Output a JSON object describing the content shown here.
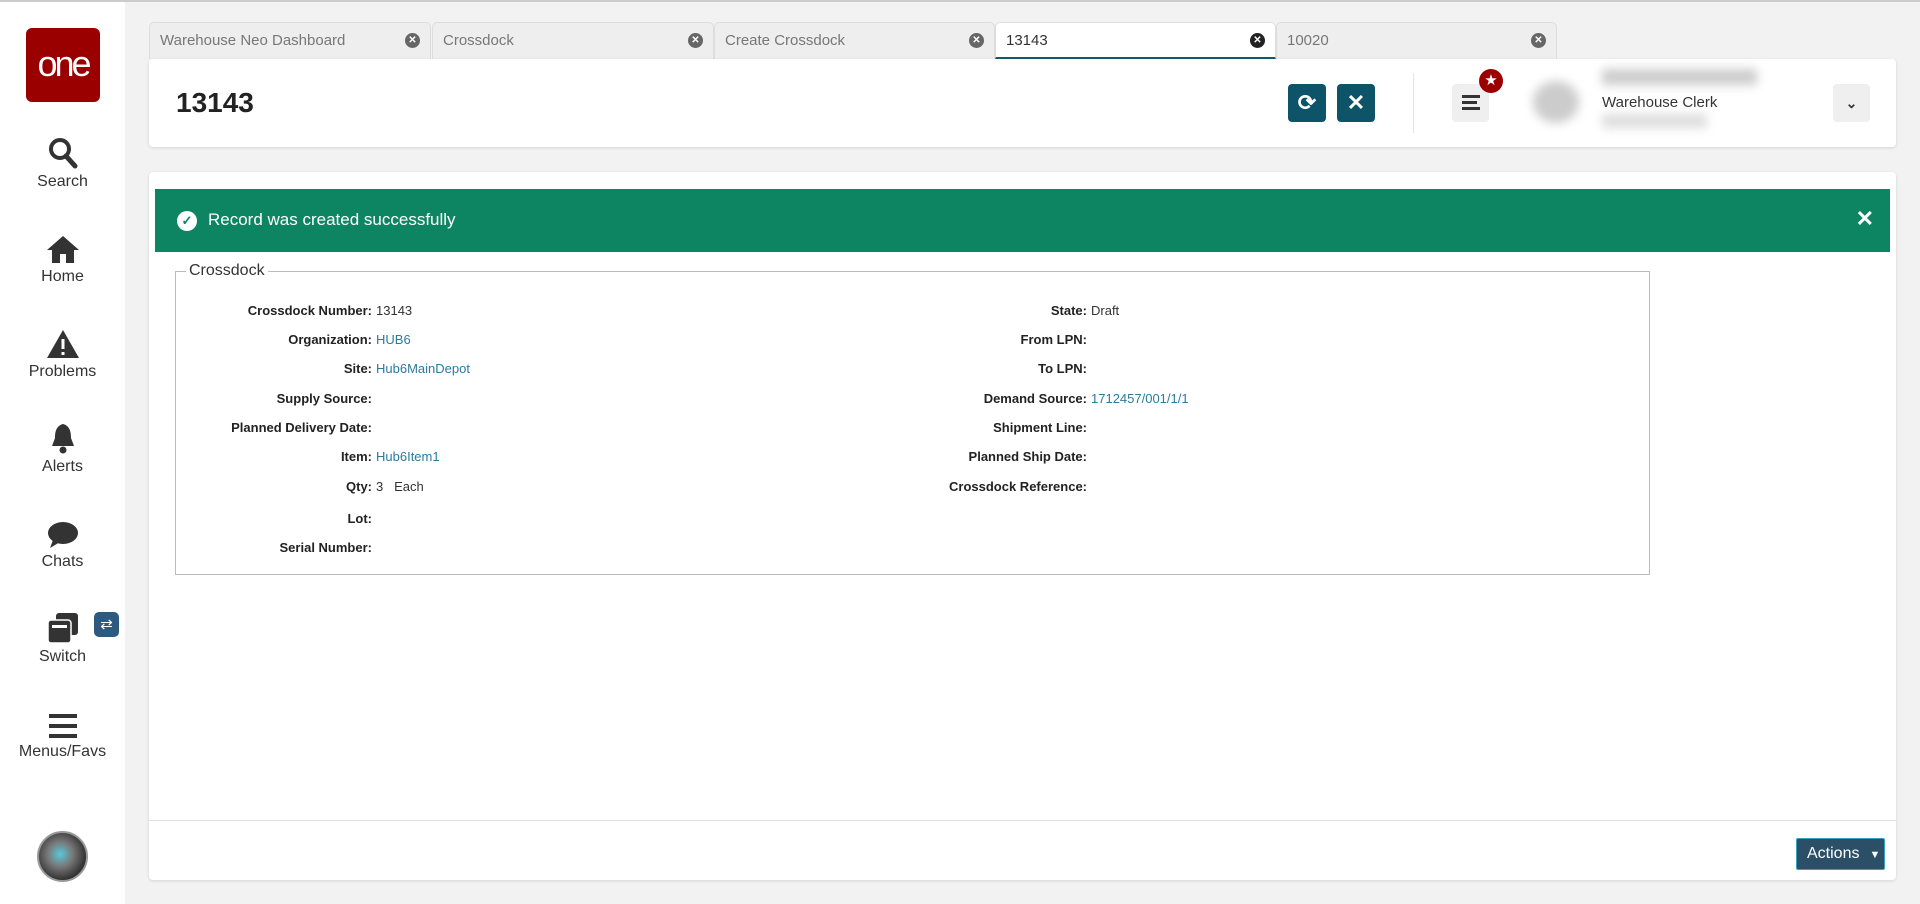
{
  "sidebar": {
    "logo": "one",
    "items": [
      {
        "label": "Search"
      },
      {
        "label": "Home"
      },
      {
        "label": "Problems"
      },
      {
        "label": "Alerts"
      },
      {
        "label": "Chats"
      },
      {
        "label": "Switch"
      },
      {
        "label": "Menus/Favs"
      }
    ],
    "switch_badge": "⇄"
  },
  "tabs": [
    {
      "label": "Warehouse Neo Dashboard"
    },
    {
      "label": "Crossdock"
    },
    {
      "label": "Create Crossdock"
    },
    {
      "label": "13143",
      "active": true
    },
    {
      "label": "10020"
    }
  ],
  "header": {
    "title": "13143",
    "user_role": "Warehouse Clerk"
  },
  "banner": {
    "message": "Record was created successfully"
  },
  "section": {
    "legend": "Crossdock",
    "left": [
      {
        "label": "Crossdock Number:",
        "value": "13143"
      },
      {
        "label": "Organization:",
        "value": "HUB6"
      },
      {
        "label": "Site:",
        "value": "Hub6MainDepot"
      },
      {
        "label": "Supply Source:",
        "value": ""
      },
      {
        "label": "Planned Delivery Date:",
        "value": ""
      },
      {
        "label": "Item:",
        "value": "Hub6Item1"
      },
      {
        "label": "Qty:",
        "value": "3   Each"
      },
      {
        "label": "Lot:",
        "value": ""
      },
      {
        "label": "Serial Number:",
        "value": ""
      }
    ],
    "right": [
      {
        "label": "State:",
        "value": "Draft"
      },
      {
        "label": "From LPN:",
        "value": ""
      },
      {
        "label": "To LPN:",
        "value": ""
      },
      {
        "label": "Demand Source:",
        "value": "1712457/001/1/1"
      },
      {
        "label": "Shipment Line:",
        "value": ""
      },
      {
        "label": "Planned Ship Date:",
        "value": ""
      },
      {
        "label": "Crossdock Reference:",
        "value": ""
      }
    ]
  },
  "footer": {
    "actions_label": "Actions"
  },
  "colors": {
    "brand": "#9b0000",
    "primary": "#0e5468",
    "success": "#0e8562",
    "link": "#2a7c9c"
  }
}
